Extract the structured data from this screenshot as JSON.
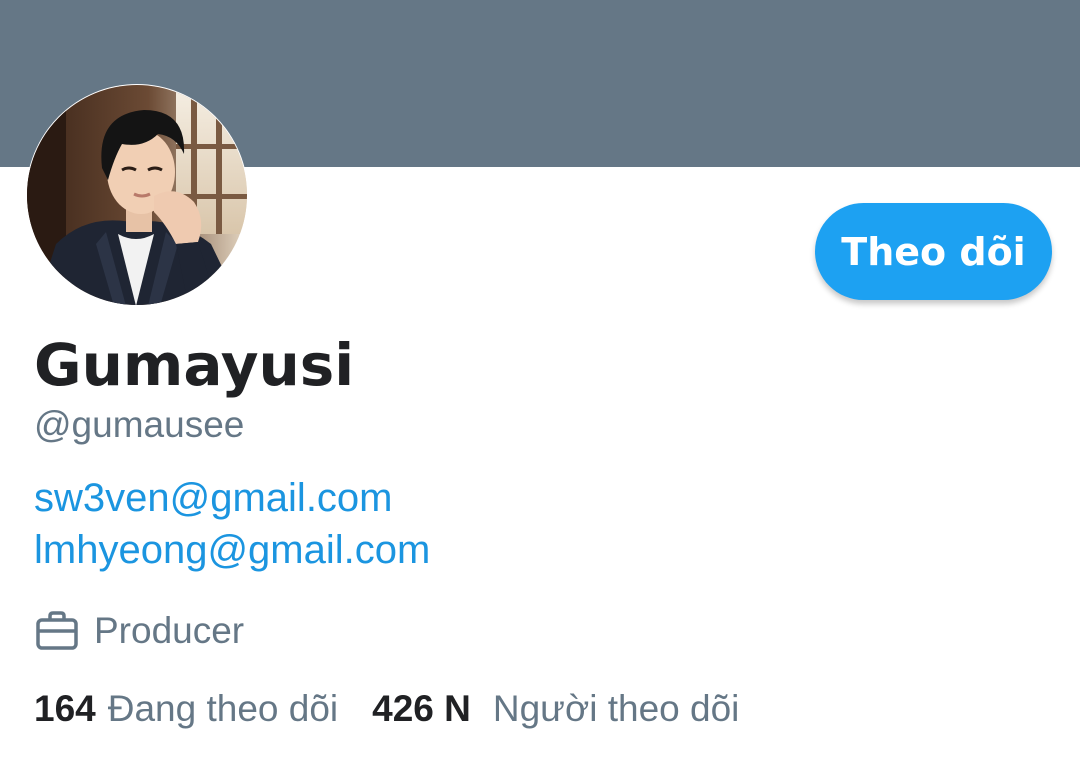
{
  "header": {
    "banner_color": "#657786"
  },
  "profile": {
    "avatar_icon": "profile-photo",
    "follow_button_label": "Theo dõi",
    "display_name": "Gumayusi",
    "handle": "@gumausee",
    "bio_links": [
      "sw3ven@gmail.com",
      "lmhyeong@gmail.com"
    ],
    "occupation_icon": "briefcase-icon",
    "occupation": "Producer",
    "following_count": "164",
    "following_label": "Đang theo dõi",
    "followers_count": "426 N",
    "followers_label": "Người theo dõi"
  },
  "colors": {
    "accent": "#1da1f2",
    "link": "#1b95e0",
    "secondary_text": "#657786",
    "primary_text": "#202124"
  }
}
